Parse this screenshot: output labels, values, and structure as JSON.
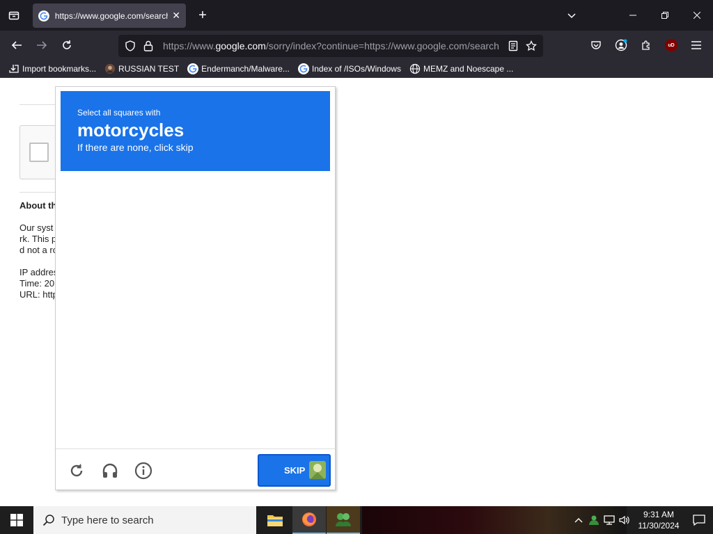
{
  "browser": {
    "tab": {
      "title": "https://www.google.com/search"
    },
    "url": {
      "prefix": "https://www.",
      "host": "google.com",
      "rest": "/sorry/index?continue=https://www.google.com/search"
    },
    "bookmarks": [
      {
        "label": "Import bookmarks...",
        "icon": "import-icon"
      },
      {
        "label": "RUSSIAN TEST",
        "icon": "avatar-icon"
      },
      {
        "label": "Endermanch/Malware...",
        "icon": "google-icon"
      },
      {
        "label": "Index of /ISOs/Windows",
        "icon": "google-icon"
      },
      {
        "label": "MEMZ and Noescape ...",
        "icon": "globe-icon"
      }
    ],
    "addon_badge": "uD"
  },
  "page": {
    "about_title": "About th",
    "lines": [
      "Our syst",
      "rk. This p",
      "d not a ro",
      "IP addres",
      "Time: 20",
      "URL: http"
    ]
  },
  "captcha": {
    "instruction_small": "Select all squares with",
    "target": "motorcycles",
    "instruction_sub": "If there are none, click skip",
    "skip_label": "SKIP",
    "colors": {
      "header": "#1a73e8",
      "button": "#1a73e8"
    }
  },
  "taskbar": {
    "search_placeholder": "Type here to search",
    "time": "9:31 AM",
    "date": "11/30/2024"
  }
}
